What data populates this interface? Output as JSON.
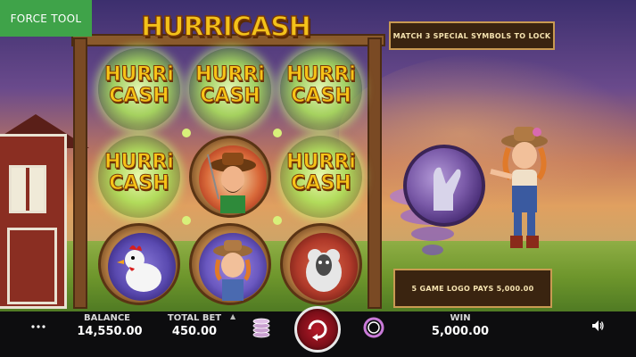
{
  "toolbar": {
    "force_tool_label": "FORCE TOOL"
  },
  "game": {
    "logo_text": "HURRICASH",
    "hint_banner": "MATCH 3 SPECIAL SYMBOLS TO LOCK",
    "pays_banner": "5 GAME LOGO PAYS 5,000.00"
  },
  "reels": {
    "cells": [
      {
        "symbol": "hurricash-logo",
        "line1": "HURRi",
        "line2": "CASH"
      },
      {
        "symbol": "hurricash-logo",
        "line1": "HURRi",
        "line2": "CASH"
      },
      {
        "symbol": "hurricash-logo",
        "line1": "HURRi",
        "line2": "CASH"
      },
      {
        "symbol": "hurricash-logo",
        "line1": "HURRi",
        "line2": "CASH"
      },
      {
        "symbol": "farmer"
      },
      {
        "symbol": "hurricash-logo",
        "line1": "HURRi",
        "line2": "CASH"
      },
      {
        "symbol": "rooster"
      },
      {
        "symbol": "farm-girl"
      },
      {
        "symbol": "sheep"
      }
    ]
  },
  "bottom_bar": {
    "balance_label": "BALANCE",
    "balance_value": "14,550.00",
    "total_bet_label": "TOTAL BET",
    "total_bet_value": "450.00",
    "win_label": "WIN",
    "win_value": "5,000.00",
    "icons": [
      "menu-icon",
      "chip-stack-icon",
      "spin-icon",
      "autoplay-icon",
      "sound-icon"
    ]
  },
  "colors": {
    "force_tool_bg": "#3fa349",
    "logo_gold": "#f4c21a",
    "banner_bg": "#3a2410",
    "banner_border": "#c99a52",
    "bar_bg": "#0d0d0f",
    "spin_red": "#b81a2a"
  }
}
